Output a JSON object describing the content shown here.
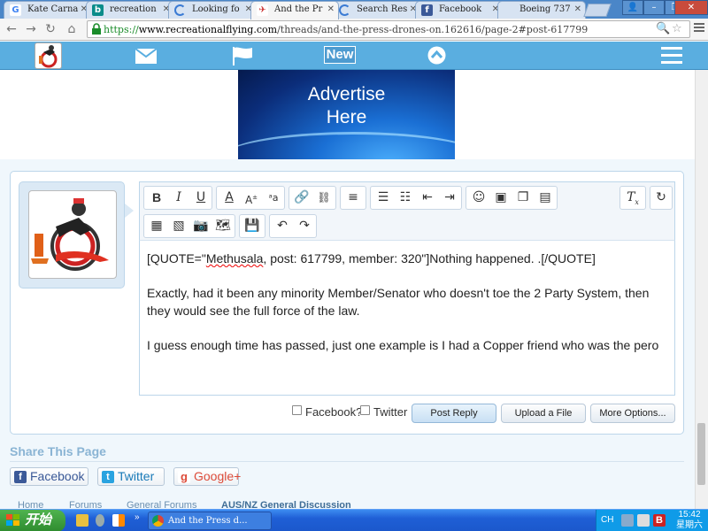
{
  "browser": {
    "tabs": [
      {
        "title": "Kate Carna",
        "icon": "google-icon"
      },
      {
        "title": "recreation",
        "icon": "bing-icon"
      },
      {
        "title": "Looking fo",
        "icon": "loading-icon"
      },
      {
        "title": "And the Pr",
        "icon": "site-icon"
      },
      {
        "title": "Search Res",
        "icon": "loading-icon"
      },
      {
        "title": "Facebook",
        "icon": "facebook-icon"
      },
      {
        "title": "Boeing 737",
        "icon": "none"
      }
    ],
    "url_scheme": "https://",
    "url_host": "www.recreationalflying.com",
    "url_path": "/threads/and-the-press-drones-on.162616/page-2#post-617799"
  },
  "site_nav": {
    "new_label": "New"
  },
  "ad": {
    "line1": "Advertise",
    "line2": "Here"
  },
  "editor": {
    "paragraphs": {
      "quote_open": "[QUOTE=\"",
      "quote_name": "Methusala",
      "quote_rest": ", post: 617799, member: 320\"]Nothing happened. .[/QUOTE]",
      "p2": "Exactly, had it been any minority Member/Senator who doesn't toe the 2 Party System, then they would see the full force of the law.",
      "p3": "I guess enough time has passed, just one example is I had a Copper friend who was the pero"
    }
  },
  "submit": {
    "facebook_label": "Facebook?",
    "twitter_label": "Twitter",
    "post_reply": "Post Reply",
    "upload": "Upload a File",
    "more_options": "More Options..."
  },
  "share": {
    "title": "Share This Page",
    "facebook": "Facebook",
    "twitter": "Twitter",
    "google": "Google+"
  },
  "breadcrumb": [
    "Home",
    "Forums",
    "General Forums",
    "AUS/NZ General Discussion"
  ],
  "taskbar": {
    "start_label": "开始",
    "active_task": "And the Press d...",
    "lang": "CH",
    "time": "15:42",
    "day": "星期六"
  },
  "colors": {
    "site_nav": "#5aaee0",
    "taskbar": "#1f5fd6",
    "start": "#2e8b2e"
  }
}
